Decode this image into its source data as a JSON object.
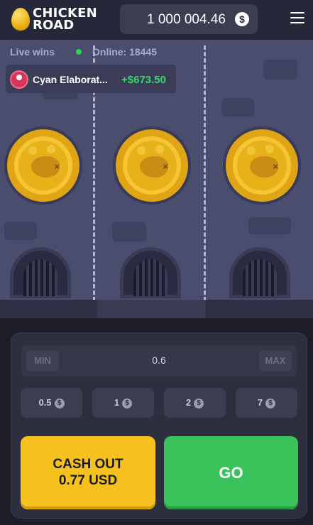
{
  "header": {
    "logo_line1": "CHICKEN",
    "logo_line2": "ROAD",
    "balance": "1 000 004.46",
    "currency_symbol": "$"
  },
  "live": {
    "label": "Live wins",
    "online": "Online: 18445",
    "recent_win": {
      "name": "Cyan Elaborat...",
      "amount": "+$673.50"
    }
  },
  "bet": {
    "min_label": "MIN",
    "max_label": "MAX",
    "value": "0.6",
    "chips": [
      "0.5",
      "1",
      "2",
      "7"
    ],
    "chip_currency": "$"
  },
  "actions": {
    "cashout_line1": "CASH OUT",
    "cashout_line2": "0.77 USD",
    "go_label": "GO"
  },
  "colors": {
    "cashout": "#f6c11f",
    "go": "#3ac35a",
    "win_amount": "#38d76a"
  }
}
